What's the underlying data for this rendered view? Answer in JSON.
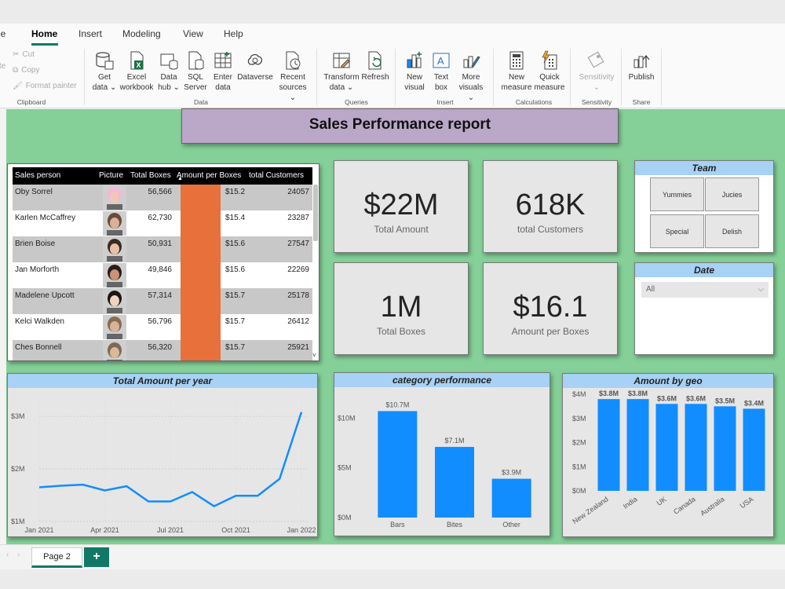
{
  "menu": {
    "tabs": [
      "le",
      "Home",
      "Insert",
      "Modeling",
      "View",
      "Help"
    ],
    "active": "Home"
  },
  "ribbon": {
    "clipboard": {
      "cut": "Cut",
      "copy": "Copy",
      "paste_partial": "te",
      "format_painter": "Format painter",
      "label": "Clipboard"
    },
    "data": {
      "label": "Data",
      "buttons": [
        {
          "line1": "Get",
          "line2": "data ⌄"
        },
        {
          "line1": "Excel",
          "line2": "workbook"
        },
        {
          "line1": "Data",
          "line2": "hub ⌄"
        },
        {
          "line1": "SQL",
          "line2": "Server"
        },
        {
          "line1": "Enter",
          "line2": "data"
        },
        {
          "line1": "Dataverse",
          "line2": ""
        },
        {
          "line1": "Recent",
          "line2": "sources ⌄"
        }
      ]
    },
    "queries": {
      "label": "Queries",
      "buttons": [
        {
          "line1": "Transform",
          "line2": "data ⌄"
        },
        {
          "line1": "Refresh",
          "line2": ""
        }
      ]
    },
    "insert": {
      "label": "Insert",
      "buttons": [
        {
          "line1": "New",
          "line2": "visual"
        },
        {
          "line1": "Text",
          "line2": "box"
        },
        {
          "line1": "More",
          "line2": "visuals ⌄"
        }
      ]
    },
    "calculations": {
      "label": "Calculations",
      "buttons": [
        {
          "line1": "New",
          "line2": "measure"
        },
        {
          "line1": "Quick",
          "line2": "measure"
        }
      ]
    },
    "sensitivity": {
      "label": "Sensitivity",
      "button": "Sensitivity",
      "sub": "⌄"
    },
    "share": {
      "label": "Share",
      "button": "Publish"
    }
  },
  "report": {
    "title": "Sales Performance report",
    "table": {
      "headers": [
        "Sales person",
        "Picture",
        "Total Boxes",
        "Amount per Boxes",
        "total Customers"
      ],
      "rows": [
        {
          "name": "Oby Sorrel",
          "boxes": "56,566",
          "amount": "$15.2",
          "customers": "24057"
        },
        {
          "name": "Karlen McCaffrey",
          "boxes": "62,730",
          "amount": "$15.4",
          "customers": "23287"
        },
        {
          "name": "Brien Boise",
          "boxes": "50,931",
          "amount": "$15.6",
          "customers": "27547"
        },
        {
          "name": "Jan Morforth",
          "boxes": "49,846",
          "amount": "$15.6",
          "customers": "22269"
        },
        {
          "name": "Madelene Upcott",
          "boxes": "57,314",
          "amount": "$15.7",
          "customers": "25178"
        },
        {
          "name": "Kelci Walkden",
          "boxes": "56,796",
          "amount": "$15.7",
          "customers": "26412"
        },
        {
          "name": "Ches Bonnell",
          "boxes": "56,320",
          "amount": "$15.7",
          "customers": "25921"
        }
      ]
    },
    "kpis": [
      {
        "value": "$22M",
        "label": "Total Amount"
      },
      {
        "value": "618K",
        "label": "total Customers"
      },
      {
        "value": "1M",
        "label": "Total Boxes"
      },
      {
        "value": "$16.1",
        "label": "Amount per Boxes"
      }
    ],
    "team_slicer": {
      "title": "Team",
      "options": [
        "Yummies",
        "Jucies",
        "Special",
        "Delish"
      ]
    },
    "date_slicer": {
      "title": "Date",
      "selected": "All"
    }
  },
  "colors": {
    "canvas_bg": "#84d098",
    "bar_blue": "#118dff",
    "table_bar": "#e8703a",
    "visual_header": "#a7d1f5",
    "title_bg": "#bba7c8",
    "accent_green": "#117865"
  },
  "chart_data": [
    {
      "type": "line",
      "title": "Total Amount per year",
      "x_ticks": [
        "Jan 2021",
        "Apr 2021",
        "Jul 2021",
        "Oct 2021",
        "Jan 2022"
      ],
      "y_ticks": [
        "$1M",
        "$2M",
        "$3M"
      ],
      "ylim": [
        1.0,
        3.3
      ],
      "x": [
        "2021-01",
        "2021-02",
        "2021-03",
        "2021-04",
        "2021-05",
        "2021-06",
        "2021-07",
        "2021-08",
        "2021-09",
        "2021-10",
        "2021-11",
        "2021-12",
        "2022-01"
      ],
      "values": [
        1.65,
        1.68,
        1.7,
        1.59,
        1.67,
        1.38,
        1.38,
        1.56,
        1.29,
        1.49,
        1.49,
        1.81,
        3.08
      ],
      "grid": true
    },
    {
      "type": "bar",
      "title": "category performance",
      "categories": [
        "Bars",
        "Bites",
        "Other"
      ],
      "values": [
        10.7,
        7.1,
        3.9
      ],
      "data_labels": [
        "$10.7M",
        "$7.1M",
        "$3.9M"
      ],
      "y_ticks": [
        "$0M",
        "$5M",
        "$10M"
      ],
      "ylim": [
        0,
        12
      ]
    },
    {
      "type": "bar",
      "title": "Amount by geo",
      "categories": [
        "New Zealand",
        "India",
        "UK",
        "Canada",
        "Australia",
        "USA"
      ],
      "values": [
        3.8,
        3.8,
        3.6,
        3.6,
        3.5,
        3.4
      ],
      "data_labels": [
        "$3.8M",
        "$3.8M",
        "$3.6M",
        "$3.6M",
        "$3.5M",
        "$3.4M"
      ],
      "y_ticks": [
        "$0M",
        "$1M",
        "$2M",
        "$3M",
        "$4M"
      ],
      "ylim": [
        0,
        4
      ]
    }
  ],
  "pages": {
    "current": "Page 2",
    "add": "+"
  }
}
